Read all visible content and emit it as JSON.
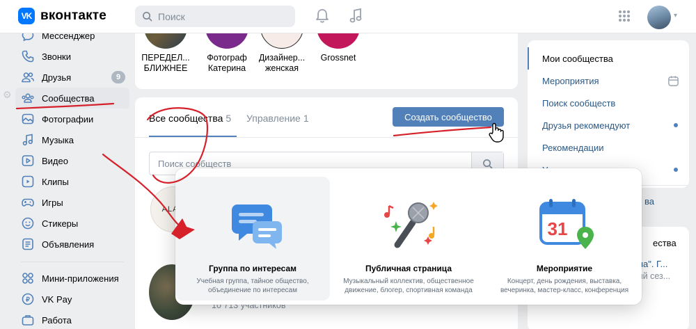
{
  "header": {
    "logo_mark": "VK",
    "logo_text": "вконтакте",
    "search_placeholder": "Поиск"
  },
  "nav": {
    "items": [
      {
        "label": "Мессенджер"
      },
      {
        "label": "Звонки"
      },
      {
        "label": "Друзья",
        "badge": "9"
      },
      {
        "label": "Сообщества"
      },
      {
        "label": "Фотографии"
      },
      {
        "label": "Музыка"
      },
      {
        "label": "Видео"
      },
      {
        "label": "Клипы"
      },
      {
        "label": "Игры"
      },
      {
        "label": "Стикеры"
      },
      {
        "label": "Объявления"
      }
    ],
    "items2": [
      {
        "label": "Мини-приложения"
      },
      {
        "label": "VK Pay"
      },
      {
        "label": "Работа"
      }
    ]
  },
  "favorites": [
    {
      "label": "ПЕРЕДЕЛ... БЛИЖНЕЕ",
      "color": "#4a5a44"
    },
    {
      "label": "Фотограф Катерина",
      "color": "#7a2a8a"
    },
    {
      "label": "Дизайнер... женская",
      "color": "#f4e6e0"
    },
    {
      "label": "Grossnet",
      "color": "#c2185b"
    }
  ],
  "communities": {
    "tab_all_label": "Все сообщества",
    "tab_all_count": "5",
    "tab_manage_label": "Управление",
    "tab_manage_count": "1",
    "create_button": "Создать сообщество",
    "search_placeholder": "Поиск сообществ",
    "first_avatar_text": "ALAN",
    "second_subtitle": "10 713 участников"
  },
  "right_menu": {
    "items": [
      {
        "label": "Мои сообщества"
      },
      {
        "label": "Мероприятия"
      },
      {
        "label": "Поиск сообществ"
      },
      {
        "label": "Друзья рекомендуют"
      },
      {
        "label": "Рекомендации"
      },
      {
        "label": "Услуги на карте"
      }
    ],
    "link_fragment": "ва",
    "section_title_fragment": "ества",
    "line1_fragment": "мпа\". Г...",
    "line2_fragment": "вый сез..."
  },
  "popup": {
    "cards": [
      {
        "title": "Группа по интересам",
        "desc": "Учебная группа, тайное общество, объединение по интересам"
      },
      {
        "title": "Публичная страница",
        "desc": "Музыкальный коллектив, общественное движение, блогер, спортивная команда"
      },
      {
        "title": "Мероприятие",
        "desc": "Концерт, день рождения, выставка, вечеринка, мастер-класс, конференция",
        "calendar_day": "31"
      }
    ]
  },
  "colors": {
    "brand": "#0077ff",
    "accent": "#5181b8",
    "annotation": "#d6202a"
  }
}
